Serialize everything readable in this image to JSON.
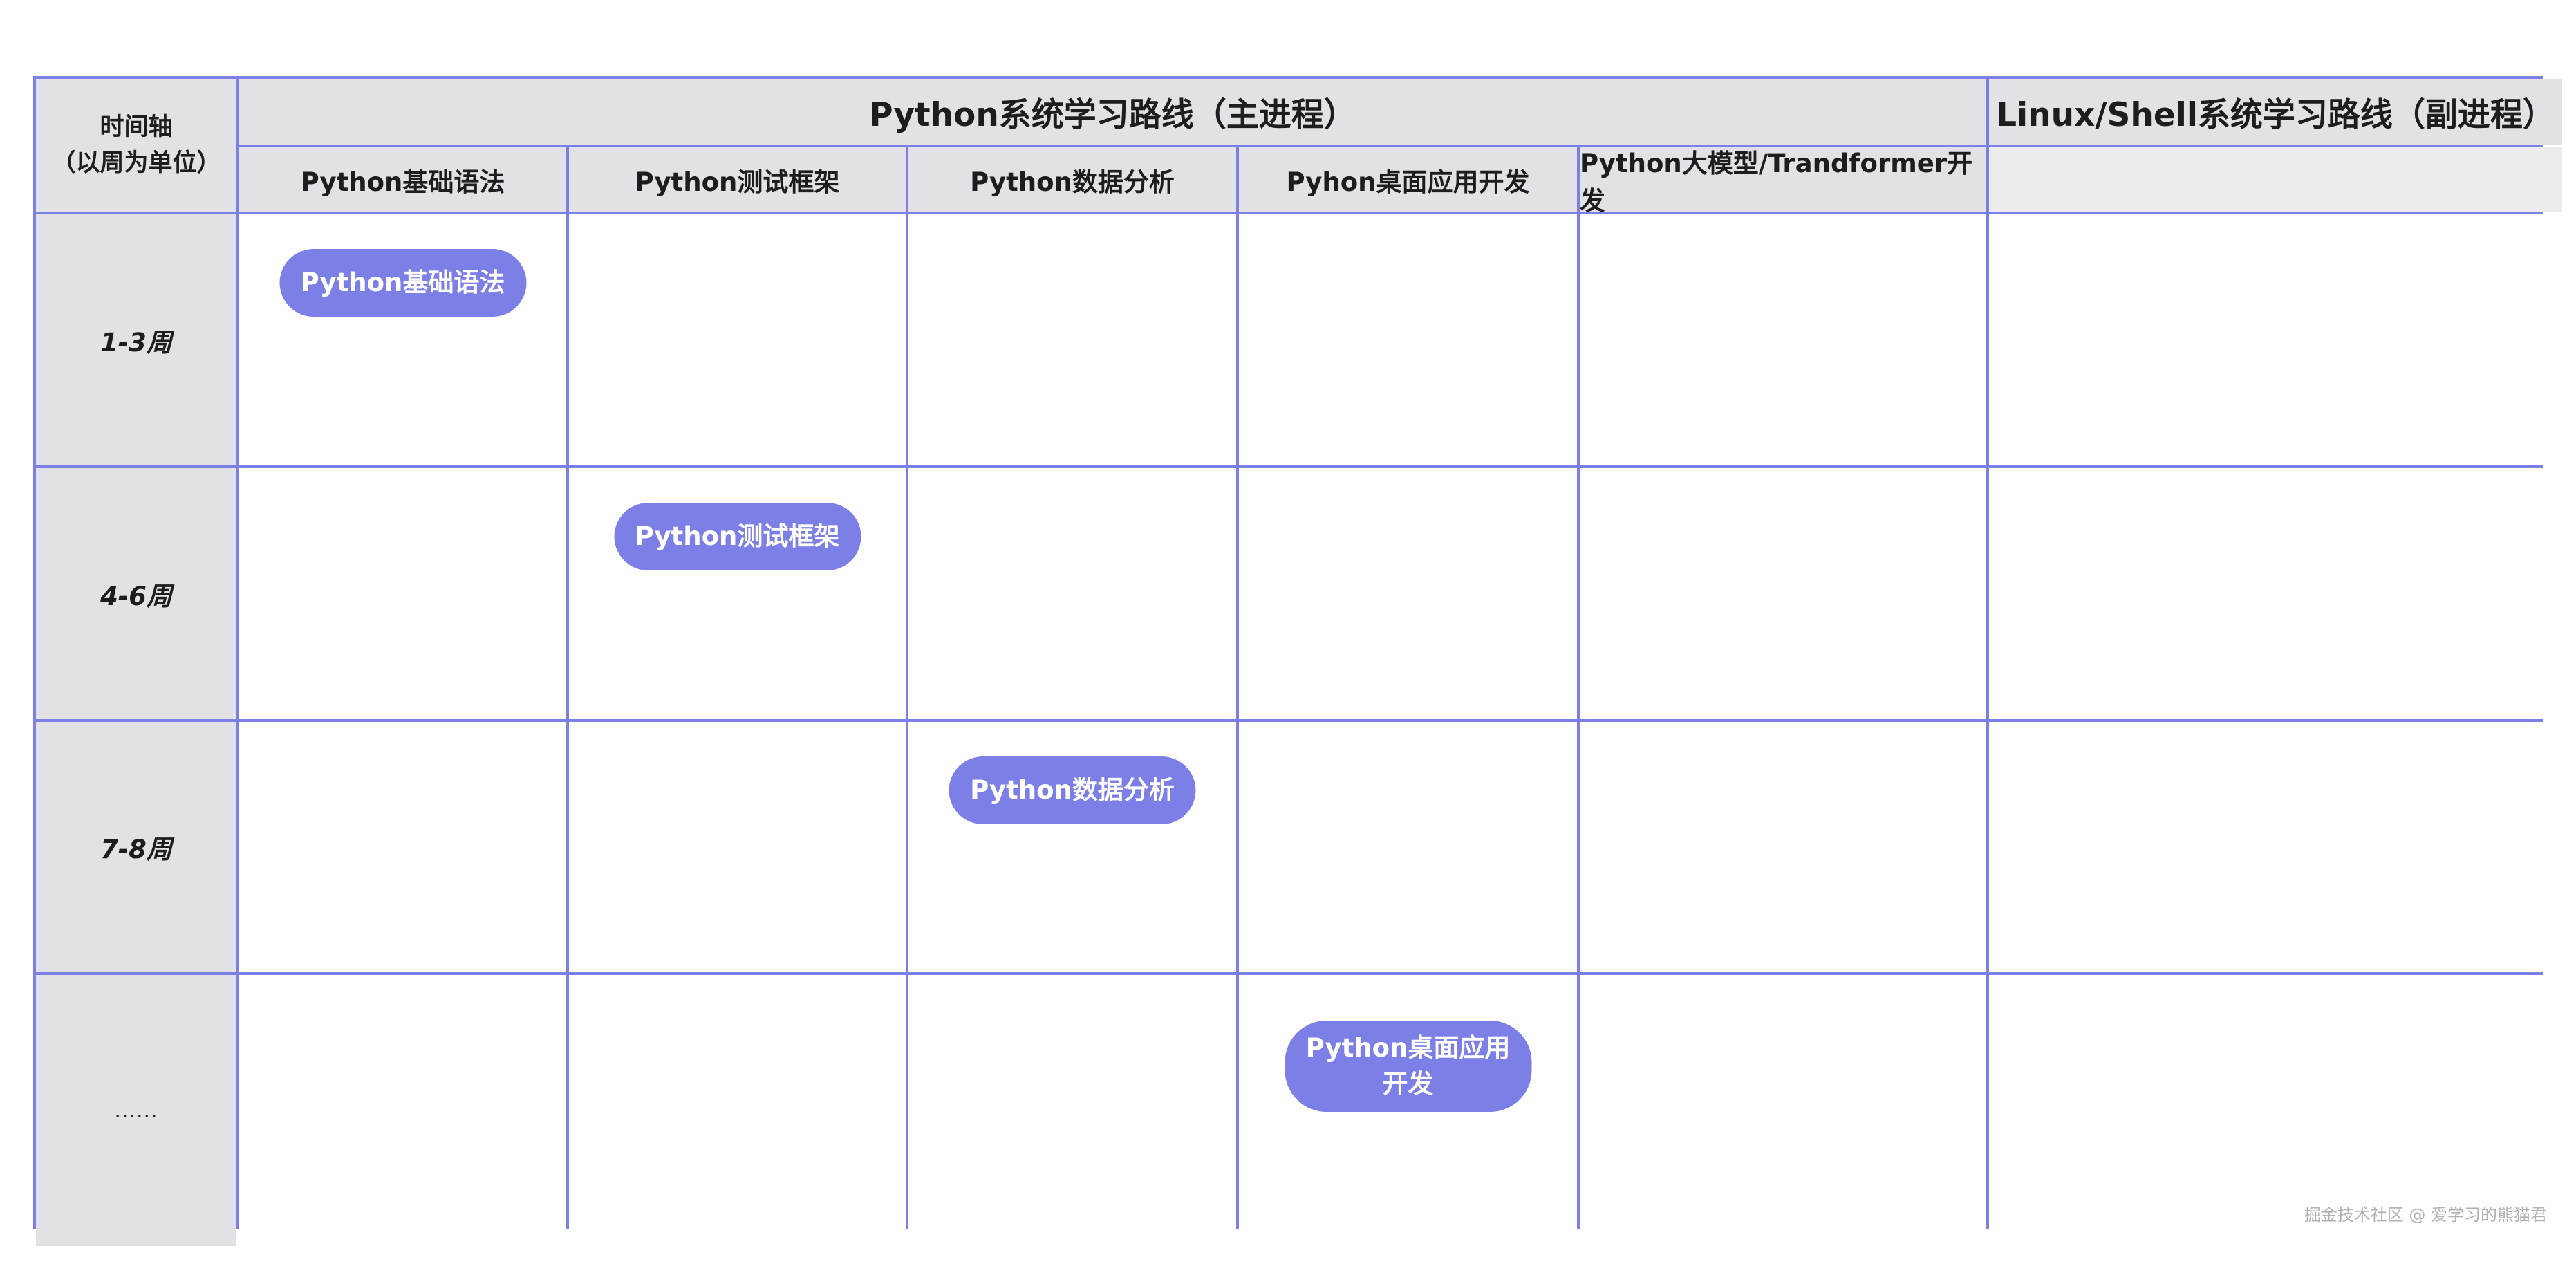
{
  "header": {
    "time_axis_line1": "时间轴",
    "time_axis_line2": "（以周为单位）",
    "main_title": "Python系统学习路线（主进程）",
    "side_title": "Linux/Shell系统学习路线（副进程）"
  },
  "columns": [
    "Python基础语法",
    "Python测试框架",
    "Python数据分析",
    "Pyhon桌面应用开发",
    "Python大模型/Trandformer开发"
  ],
  "rows": [
    {
      "label": "1-3周"
    },
    {
      "label": "4-6周"
    },
    {
      "label": "7-8周"
    },
    {
      "label": "......"
    }
  ],
  "pills": {
    "p1": "Python基础语法",
    "p2": "Python测试框架",
    "p3": "Python数据分析",
    "p4_line1": "Python桌面应用",
    "p4_line2": "开发"
  },
  "colors": {
    "grid": "#7b7fe6",
    "header_bg": "#e1e1e6",
    "pill_bg": "#7b7fe6"
  },
  "watermark": "掘金技术社区 @ 爱学习的熊猫君"
}
